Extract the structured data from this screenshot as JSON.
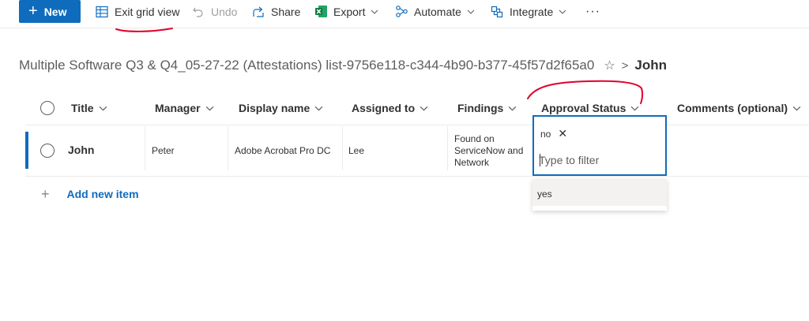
{
  "toolbar": {
    "new_label": "New",
    "exit_grid_label": "Exit grid view",
    "undo_label": "Undo",
    "share_label": "Share",
    "export_label": "Export",
    "automate_label": "Automate",
    "integrate_label": "Integrate",
    "more_label": "···"
  },
  "breadcrumb": {
    "list_name": "Multiple Software Q3 & Q4_05-27-22 (Attestations) list-9756e118-c344-4b90-b377-45f57d2f65a0",
    "separator": ">",
    "current": "John"
  },
  "columns": [
    "Title",
    "Manager",
    "Display name",
    "Assigned to",
    "Findings",
    "Approval Status",
    "Comments (optional)"
  ],
  "rows": [
    {
      "title": "John",
      "manager": "Peter",
      "display_name": "Adobe Acrobat Pro DC",
      "assigned_to": "Lee",
      "findings_lines": [
        "Found on",
        "ServiceNow and",
        "Network"
      ]
    }
  ],
  "add_new_item_label": "Add new item",
  "filter": {
    "selected_tag": "no",
    "placeholder": "Type to filter",
    "options": [
      "yes"
    ]
  },
  "colors": {
    "accent": "#0f6cbd",
    "annotation": "#e3002b",
    "excel_green": "#107c41"
  }
}
